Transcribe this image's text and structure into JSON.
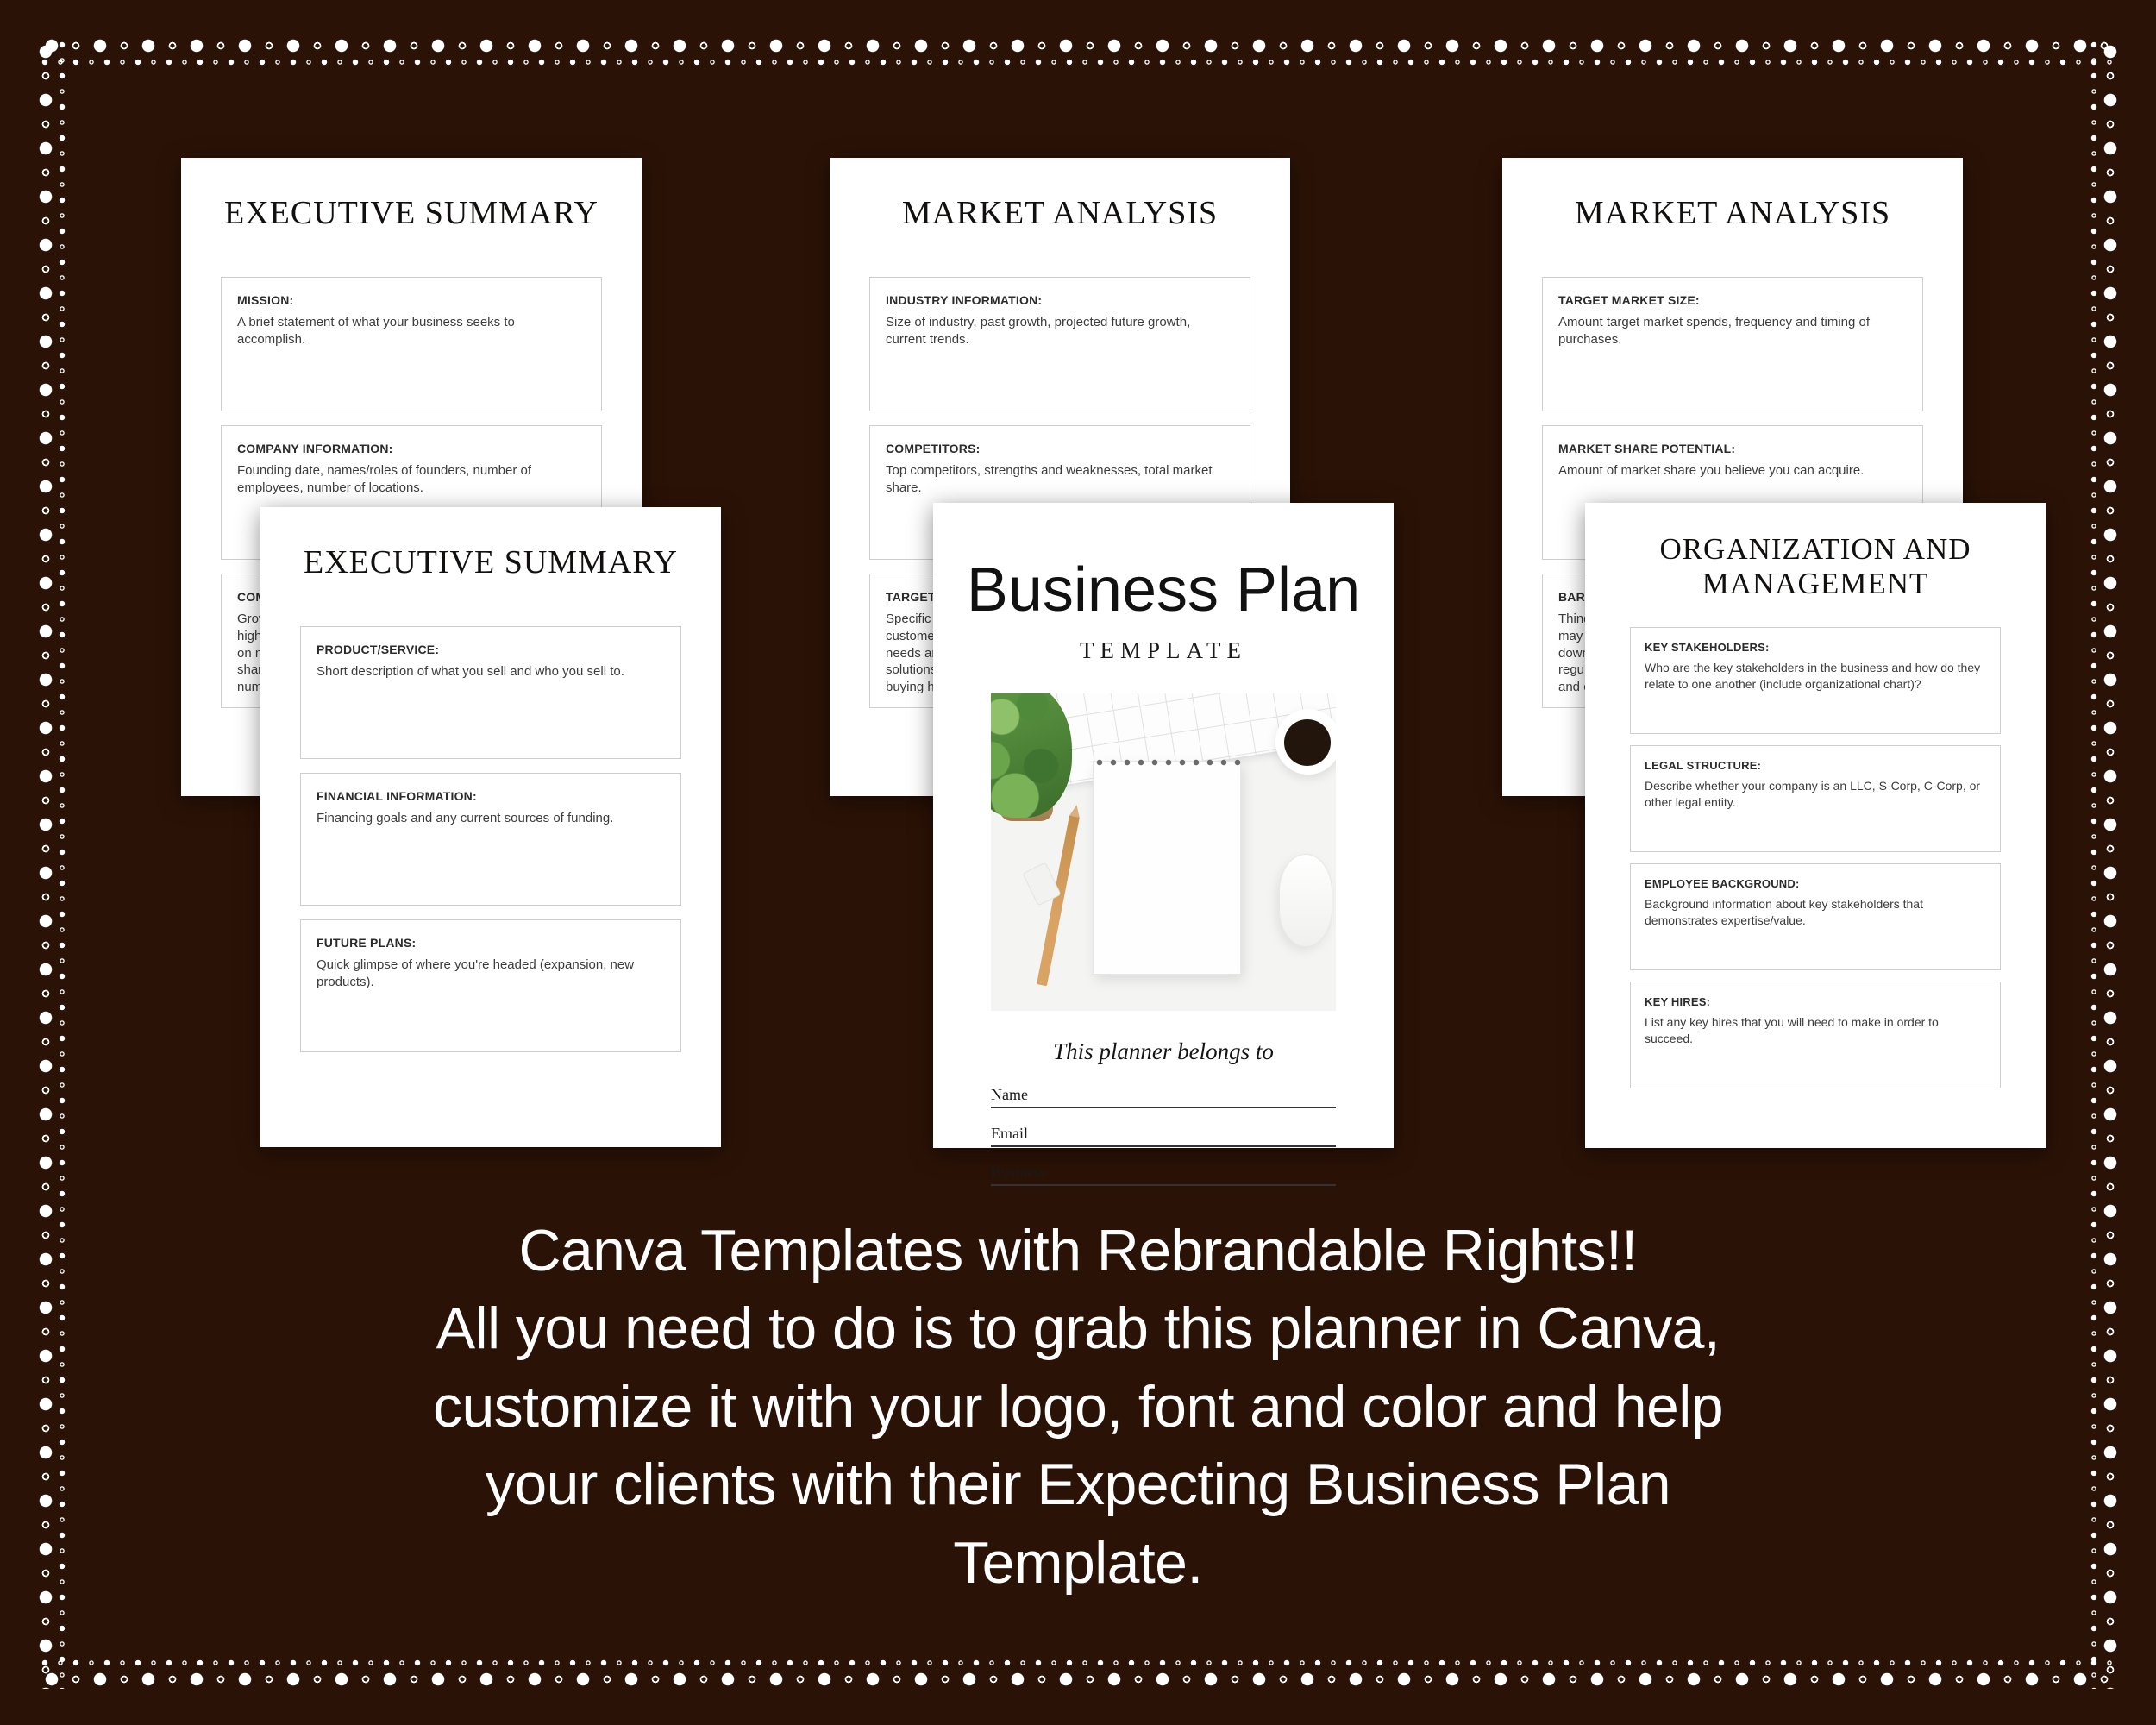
{
  "background_color": "#2b1206",
  "border": {
    "style": "beaded-dotted",
    "color": "#ffffff"
  },
  "pages": [
    {
      "id": "executive-summary-back",
      "title": "EXECUTIVE SUMMARY",
      "fields": [
        {
          "label": "MISSION:",
          "hint": "A brief statement of what your business seeks to accomplish."
        },
        {
          "label": "COMPANY INFORMATION:",
          "hint": "Founding date, names/roles of founders, number of employees, number of locations."
        },
        {
          "label": "COMPANY GROWTH:",
          "hint": "Growth highlights, data on market share, hard numbers."
        }
      ]
    },
    {
      "id": "market-analysis-1",
      "title": "MARKET ANALYSIS",
      "fields": [
        {
          "label": "INDUSTRY INFORMATION:",
          "hint": "Size of industry, past growth, projected future growth, current trends."
        },
        {
          "label": "COMPETITORS:",
          "hint": "Top competitors, strengths and weaknesses, total market share."
        },
        {
          "label": "TARGET MARKET:",
          "hint": "Specific customer needs and solutions, buying habits."
        }
      ]
    },
    {
      "id": "market-analysis-2",
      "title": "MARKET ANALYSIS",
      "fields": [
        {
          "label": "TARGET MARKET SIZE:",
          "hint": "Amount target market spends, frequency and timing of purchases."
        },
        {
          "label": "MARKET SHARE POTENTIAL:",
          "hint": "Amount of market share you believe you can acquire."
        },
        {
          "label": "BARRIERS TO ENTRY:",
          "hint": "Things that may slow you down, regulations and costs."
        }
      ]
    },
    {
      "id": "executive-summary-front",
      "title": "EXECUTIVE SUMMARY",
      "fields": [
        {
          "label": "PRODUCT/SERVICE:",
          "hint": "Short description of what you sell and who you sell to."
        },
        {
          "label": "FINANCIAL INFORMATION:",
          "hint": "Financing goals and any current sources of funding."
        },
        {
          "label": "FUTURE PLANS:",
          "hint": "Quick glimpse of where you're headed (expansion, new products)."
        }
      ]
    },
    {
      "id": "organization-and-management",
      "title_line1": "ORGANIZATION AND",
      "title_line2": "MANAGEMENT",
      "fields": [
        {
          "label": "KEY STAKEHOLDERS:",
          "hint": "Who are the key stakeholders in the business and how do they relate to one another (include organizational chart)?"
        },
        {
          "label": "LEGAL STRUCTURE:",
          "hint": "Describe whether your company is an LLC, S-Corp, C-Corp, or other legal entity."
        },
        {
          "label": "EMPLOYEE BACKGROUND:",
          "hint": "Background information about key stakeholders that demonstrates expertise/value."
        },
        {
          "label": "KEY HIRES:",
          "hint": "List any key hires that you will need to make in order to succeed."
        }
      ]
    }
  ],
  "cover": {
    "title": "Business Plan",
    "subtitle": "TEMPLATE",
    "belongs_to": "This planner belongs to",
    "lines": [
      "Name",
      "Email",
      "Business"
    ],
    "photo_alt": "desk-flatlay-photo"
  },
  "caption": {
    "line1": "Canva Templates with Rebrandable Rights!!",
    "line2": "All you need to do is to grab this planner in Canva,",
    "line3": "customize it with your logo, font and color and help",
    "line4": "your clients with their Expecting Business Plan",
    "line5": "Template."
  }
}
